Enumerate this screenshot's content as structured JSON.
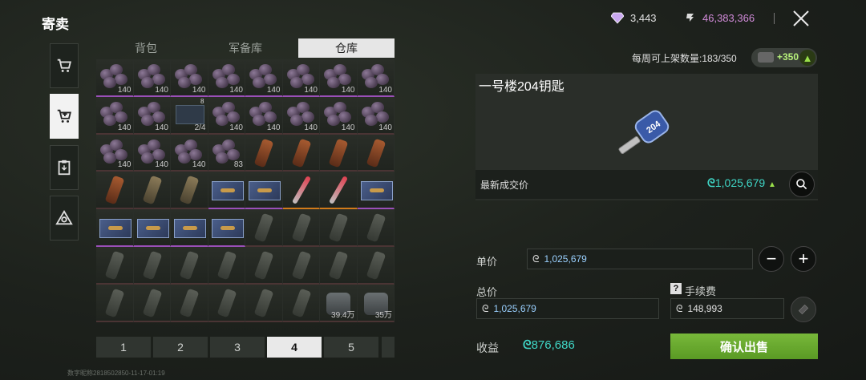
{
  "header": {
    "title": "寄卖"
  },
  "currency": {
    "diamond_amount": "3,443",
    "coin_amount": "46,383,366"
  },
  "tabs": [
    {
      "label": "背包"
    },
    {
      "label": "军备库"
    },
    {
      "label": "仓库",
      "active": true
    }
  ],
  "grid": {
    "rows": [
      [
        "140",
        "140",
        "140",
        "140",
        "140",
        "140",
        "140",
        "140"
      ],
      [
        "140",
        "140",
        "2/4",
        "140",
        "140",
        "140",
        "140",
        "140"
      ],
      [
        "140",
        "140",
        "140",
        "83",
        "",
        "",
        "",
        ""
      ],
      [
        "",
        "",
        "",
        "",
        "",
        "",
        "",
        ""
      ],
      [
        "",
        "",
        "",
        "",
        "",
        "",
        "",
        ""
      ],
      [
        "",
        "",
        "",
        "",
        "",
        "",
        "",
        ""
      ],
      [
        "",
        "",
        "",
        "",
        "",
        "",
        "39.4万",
        "35万"
      ]
    ],
    "corner_badge": "8"
  },
  "pagination": {
    "pages": [
      "1",
      "2",
      "3",
      "4",
      "5"
    ],
    "current": "4"
  },
  "footer": {
    "watermark": "数字昵称2818502850-11-17-01:19"
  },
  "listing": {
    "weekly_label": "每周可上架数量:183/350",
    "bonus_label": "+350",
    "item_name": "一号楼204钥匙",
    "key_tag": "204",
    "latest_price_label": "最新成交价",
    "latest_price": "1,025,679",
    "unit_price_label": "单价",
    "unit_price": "1,025,679",
    "total_label": "总价",
    "total_price": "1,025,679",
    "fee_label": "手续费",
    "fee": "148,993",
    "profit_label": "收益",
    "profit": "876,686",
    "confirm_label": "确认出售"
  },
  "colors": {
    "accent_green": "#6aad2e",
    "coin_teal": "#3fd6c6",
    "purple_text": "#d08ad8",
    "rarity_purple": "#9a4fb8",
    "rarity_orange": "#d07a1a"
  }
}
